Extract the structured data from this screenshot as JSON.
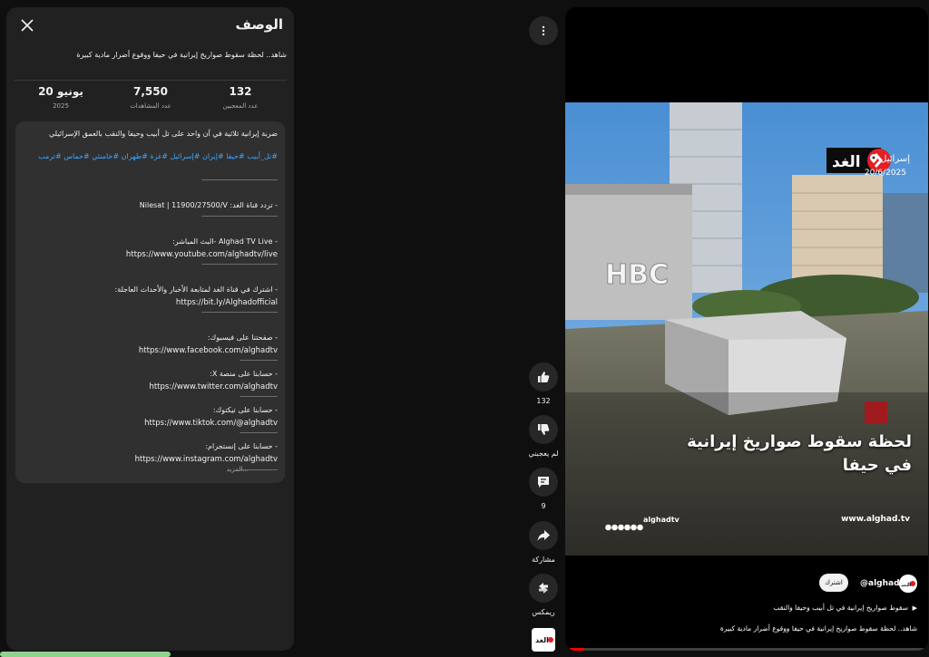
{
  "description": {
    "title": "الوصف",
    "subtitle": "شاهد.. لحظة سقوط صواريخ إيرانية في حيفا ووقوع أضرار مادية كبيرة",
    "stats": [
      {
        "value": "132",
        "label": "عدد المعجبين"
      },
      {
        "value": "7,550",
        "label": "عدد المشاهدات"
      },
      {
        "value": "20 يونيو",
        "label": "2025"
      }
    ],
    "body": {
      "headline": "ضربة إيرانية ثلاثية في آن واحد على تل أبيب وحيفا والنقب بالعمق الإسرائيلي",
      "hashtags": "#تل_أبيب #حيفا #إيران #إسرائيل #غزة #طهران #خامنئي #حماس #ترمب",
      "dash": "——————————————",
      "frequency": "- تردد قناة الغد: Nilesat | 11900/27500/V",
      "live_label": "- Alghad TV Live -البث المباشر:",
      "live_url": "https://www.youtube.com/alghadtv/live",
      "subscribe_label": "- اشترك في قناة الغد لمتابعة الأخبار والأحداث العاجلة:",
      "subscribe_url": "https://bit.ly/Alghadofficial",
      "facebook_label": "- صفحتنا على فيسبوك:",
      "facebook_url": "https://www.facebook.com/alghadtv",
      "short_dash": "———————",
      "x_label": "- حسابنا على منصة X:",
      "x_url": "https://www.twitter.com/alghadtv",
      "tiktok_label": "- حسابنا على تيكتوك:",
      "tiktok_url": "https://www.tiktok.com/@alghadtv",
      "instagram_label": "- حسابنا على إنستجرام:",
      "instagram_url": "https://www.instagram.com/alghadtv",
      "more": "...المزيد"
    }
  },
  "actions": {
    "like_count": "132",
    "dislike_label": "لم يعجبني",
    "comments_count": "9",
    "share_label": "مشاركة",
    "remix_label": "ريمكس"
  },
  "video": {
    "location": "إسرائيل",
    "date": "20/6/2025",
    "logo_text": "الغد",
    "building_sign": "HBC",
    "caption_line1": "لحظة سقوط صواريخ إيرانية",
    "caption_line2": "في حيفا",
    "handle": "alghadtv",
    "site": "www.alghad.tv",
    "progress_fraction": 0.04
  },
  "channel": {
    "name": "@alghadtv",
    "subscribe_label": "اشترك",
    "logo_text": "الغد"
  },
  "now_playing": "سقوط صواريخ إيرانية في تل أبيب وحيفا والنقب",
  "video_title": "شاهد.. لحظة سقوط صواريخ إيرانية في حيفا ووقوع أضرار مادية كبيرة",
  "colors": {
    "accent_red": "#ff0000",
    "hashtag_blue": "#3ea6ff",
    "panel_bg": "#212121"
  }
}
